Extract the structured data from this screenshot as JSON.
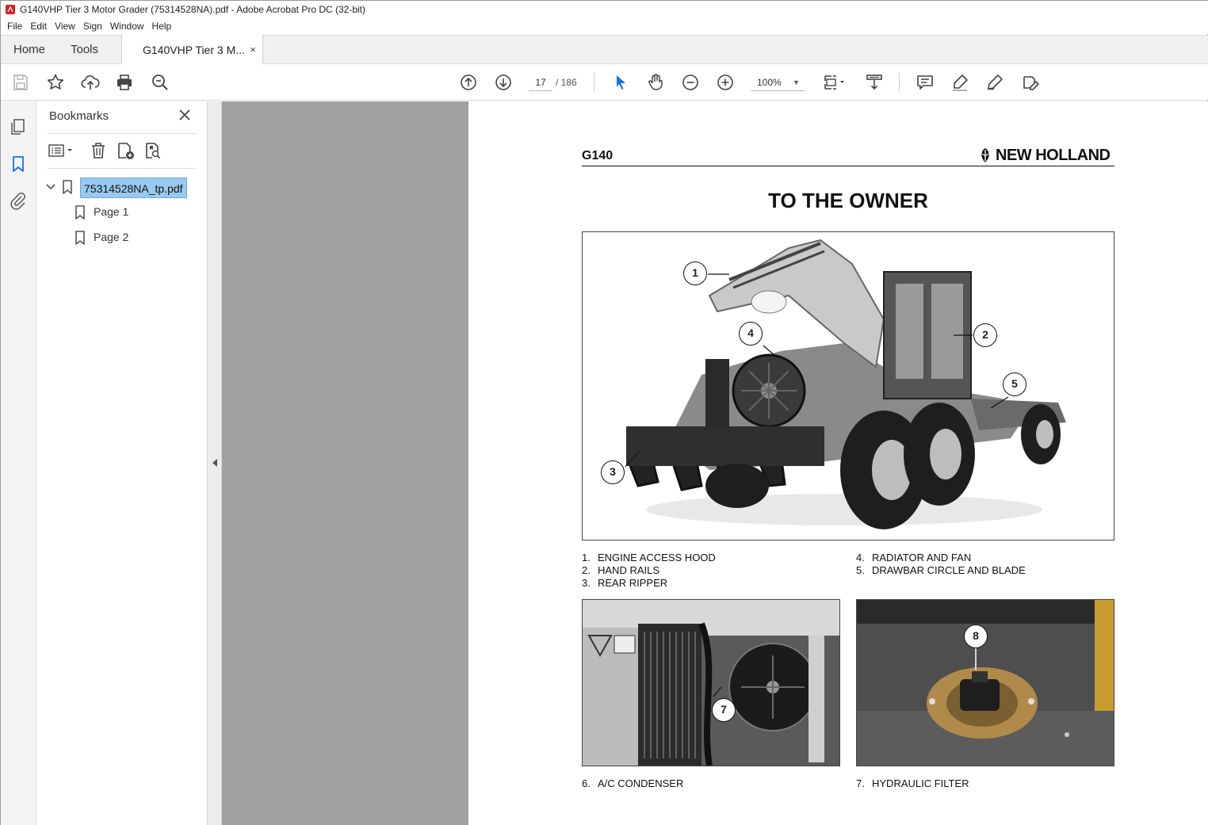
{
  "window": {
    "title": "G140VHP Tier 3 Motor Grader (75314528NA).pdf - Adobe Acrobat Pro DC (32-bit)"
  },
  "menu": [
    "File",
    "Edit",
    "View",
    "Sign",
    "Window",
    "Help"
  ],
  "tabs": {
    "home": "Home",
    "tools": "Tools",
    "document": "G140VHP Tier 3 M...",
    "close": "×"
  },
  "toolbar": {
    "current_page": "17",
    "total_pages": "/ 186",
    "zoom": "100%",
    "icons": [
      "save-icon",
      "bookmark-star-icon",
      "upload-icon",
      "print-icon",
      "search-zoom-icon",
      "page-up-icon",
      "page-down-icon",
      "select-arrow-icon",
      "hand-icon",
      "zoom-out-icon",
      "zoom-in-icon",
      "page-fit-icon",
      "scroll-mode-icon",
      "comment-icon",
      "highlight-icon",
      "draw-icon",
      "fill-sign-icon"
    ]
  },
  "bookmarks": {
    "title": "Bookmarks",
    "root": "75314528NA_tp.pdf",
    "children": [
      "Page 1",
      "Page 2"
    ]
  },
  "document": {
    "header_left": "G140",
    "brand": "NEW HOLLAND",
    "heading": "TO THE OWNER",
    "callouts": [
      "1",
      "2",
      "3",
      "4",
      "5",
      "7",
      "8"
    ],
    "captions_left": [
      {
        "n": "1.",
        "text": "ENGINE ACCESS HOOD"
      },
      {
        "n": "2.",
        "text": "HAND RAILS"
      },
      {
        "n": "3.",
        "text": "REAR RIPPER"
      }
    ],
    "captions_right": [
      {
        "n": "4.",
        "text": "RADIATOR AND FAN"
      },
      {
        "n": "5.",
        "text": "DRAWBAR CIRCLE AND BLADE"
      }
    ],
    "caption_bottom_left": {
      "n": "6.",
      "text": "A/C CONDENSER"
    },
    "caption_bottom_right": {
      "n": "7.",
      "text": "HYDRAULIC FILTER"
    }
  },
  "colors": {
    "accent_blue": "#1473e6",
    "selection": "#99c9ef",
    "doc_bg": "#a0a0a0"
  }
}
